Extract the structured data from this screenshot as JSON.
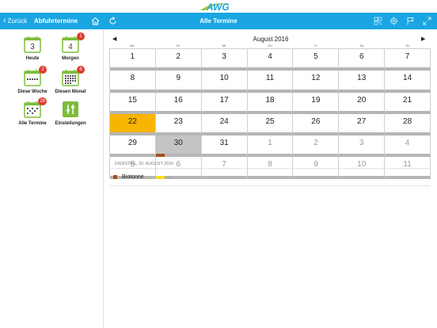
{
  "logo": {
    "text": "AWG",
    "color": "#1aa6e2",
    "accent": "#9bcb3c"
  },
  "header": {
    "back_label": "Zurück",
    "left_title": "Abfuhrtermine",
    "center_title": "Alle Termine",
    "bg_color": "#1aa6e2",
    "icons": [
      "home-icon",
      "refresh-icon",
      "qr-code-icon",
      "settings-icon",
      "flag-icon",
      "expand-icon"
    ]
  },
  "sidebar": {
    "tiles": [
      {
        "label": "Heute",
        "icon": "calendar-day-icon",
        "number": "3",
        "badge": ""
      },
      {
        "label": "Morgen",
        "icon": "calendar-day-icon",
        "number": "4",
        "badge": "1"
      },
      {
        "label": "Diese Woche",
        "icon": "calendar-week-icon",
        "number": "",
        "badge": "2"
      },
      {
        "label": "Diesen Monat",
        "icon": "calendar-month-icon",
        "number": "",
        "badge": "6"
      },
      {
        "label": "Alle Termine",
        "icon": "calendar-all-icon",
        "number": "",
        "badge": "29"
      },
      {
        "label": "Einstellungen",
        "icon": "sliders-icon",
        "number": "",
        "badge": ""
      }
    ]
  },
  "calendar": {
    "month_title": "August 2016",
    "weekdays": [
      "Mo",
      "Di",
      "Mi",
      "Do",
      "Fr",
      "Sa",
      "So"
    ],
    "weeks": [
      [
        "1",
        "2",
        "3",
        "4",
        "5",
        "6",
        "7"
      ],
      [
        "8",
        "9",
        "10",
        "11",
        "12",
        "13",
        "14"
      ],
      [
        "15",
        "16",
        "17",
        "18",
        "19",
        "20",
        "21"
      ],
      [
        "22",
        "23",
        "24",
        "25",
        "26",
        "27",
        "28"
      ],
      [
        "29",
        "30",
        "31",
        "1",
        "2",
        "3",
        "4"
      ],
      [
        "5",
        "6",
        "7",
        "8",
        "9",
        "10",
        "11"
      ]
    ],
    "today": "22",
    "selected": "30",
    "colors": {
      "today": "#f7b500",
      "selected": "#c4c4c4",
      "bio": "#a0521e",
      "yellow": "#f5e216",
      "grey": "#b0b0b0"
    }
  },
  "list": {
    "date_heading": "DIENSTAG, 30. AUGUST 2016",
    "items": [
      {
        "label": "Biotonne",
        "color": "#a0521e"
      }
    ]
  }
}
